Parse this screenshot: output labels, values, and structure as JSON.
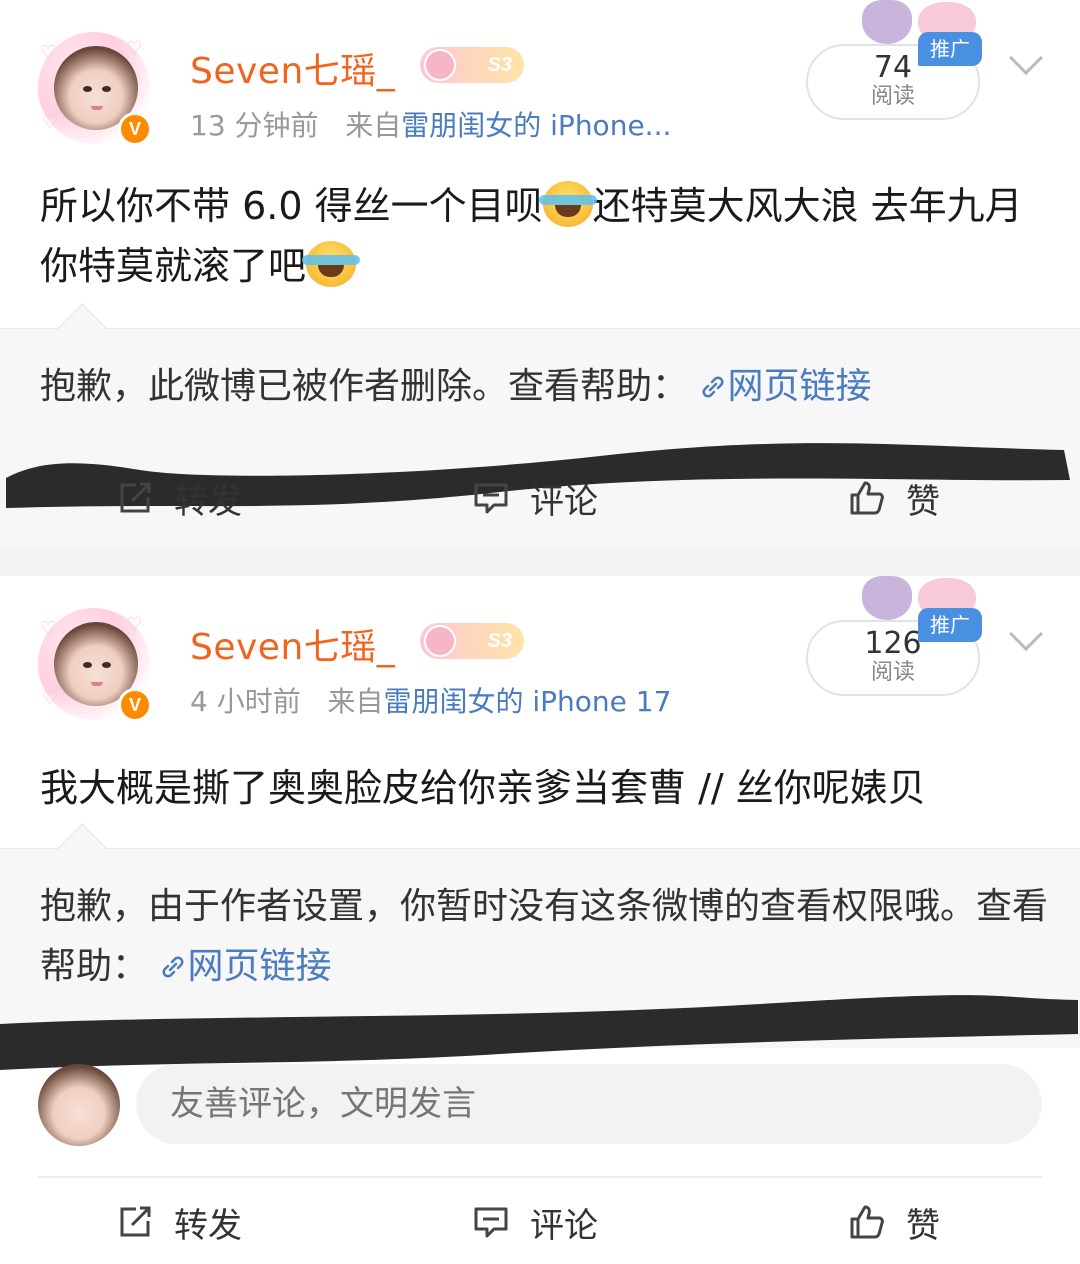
{
  "posts": [
    {
      "user": {
        "name": "Seven七瑶_",
        "level": "S3",
        "verified": "V"
      },
      "time": "13 分钟前",
      "source_prefix": "来自",
      "source": "雷朋闺女的 iPhone...",
      "reads": {
        "count": "74",
        "label": "阅读"
      },
      "promo": "推广",
      "text_1": "所以你不带 6.0 得丝一个目呗",
      "text_2": "还特莫大风大浪 去年九月你特莫就滚了吧",
      "quote": {
        "text": "抱歉，此微博已被作者删除。查看帮助：",
        "link": "网页链接"
      },
      "actions": {
        "repost": "转发",
        "comment": "评论",
        "like": "赞"
      }
    },
    {
      "user": {
        "name": "Seven七瑶_",
        "level": "S3",
        "verified": "V"
      },
      "time": "4 小时前",
      "source_prefix": "来自",
      "source": "雷朋闺女的 iPhone 17",
      "reads": {
        "count": "126",
        "label": "阅读"
      },
      "promo": "推广",
      "text": "我大概是撕了奥奥脸皮给你亲爹当套曹 // 丝你呢婊贝",
      "quote": {
        "text": "抱歉，由于作者设置，你暂时没有这条微博的查看权限哦。查看帮助：",
        "link": "网页链接"
      },
      "comment_placeholder": "友善评论，文明发言",
      "actions": {
        "repost": "转发",
        "comment": "评论",
        "like": "赞"
      }
    }
  ],
  "icons": [
    "repost-icon",
    "comment-icon",
    "like-icon",
    "chevron-down-icon",
    "link-icon",
    "emoji-laugh-icon"
  ]
}
